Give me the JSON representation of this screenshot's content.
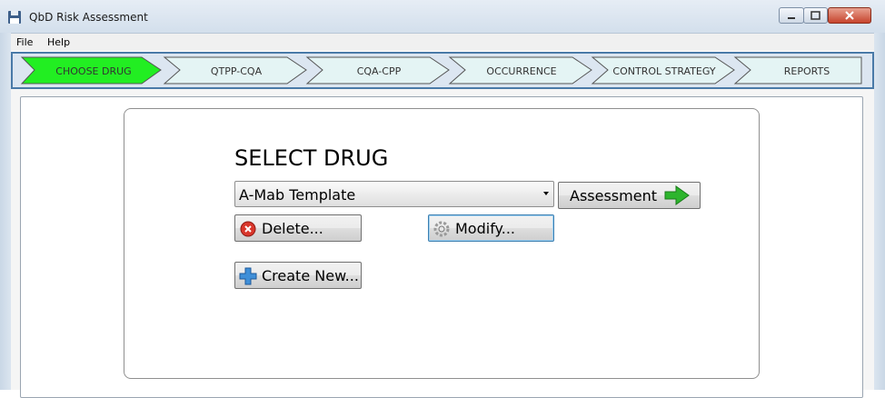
{
  "window": {
    "title": "QbD Risk Assessment",
    "icons": {
      "app": "save-disk-icon",
      "minimize": "minimize-icon",
      "maximize": "maximize-icon",
      "close": "close-icon"
    }
  },
  "menu": {
    "items": [
      "File",
      "Help"
    ]
  },
  "wizard": {
    "steps": [
      {
        "label": "CHOOSE DRUG",
        "active": true
      },
      {
        "label": "QTPP-CQA",
        "active": false
      },
      {
        "label": "CQA-CPP",
        "active": false
      },
      {
        "label": "OCCURRENCE",
        "active": false
      },
      {
        "label": "CONTROL STRATEGY",
        "active": false
      },
      {
        "label": "REPORTS",
        "active": false
      }
    ],
    "colors": {
      "active": "#22ee22",
      "inactive": "#e4f4f4",
      "bar_border": "#4a7aa8"
    }
  },
  "main": {
    "heading": "SELECT DRUG",
    "drug_select": {
      "value": "A-Mab Template"
    },
    "buttons": {
      "assessment": {
        "label": "Assessment",
        "icon": "green-arrow-right-icon"
      },
      "delete": {
        "label": "Delete...",
        "icon": "red-x-circle-icon"
      },
      "modify": {
        "label": "Modify...",
        "icon": "gear-icon"
      },
      "create": {
        "label": "Create New...",
        "icon": "blue-plus-icon"
      }
    }
  }
}
